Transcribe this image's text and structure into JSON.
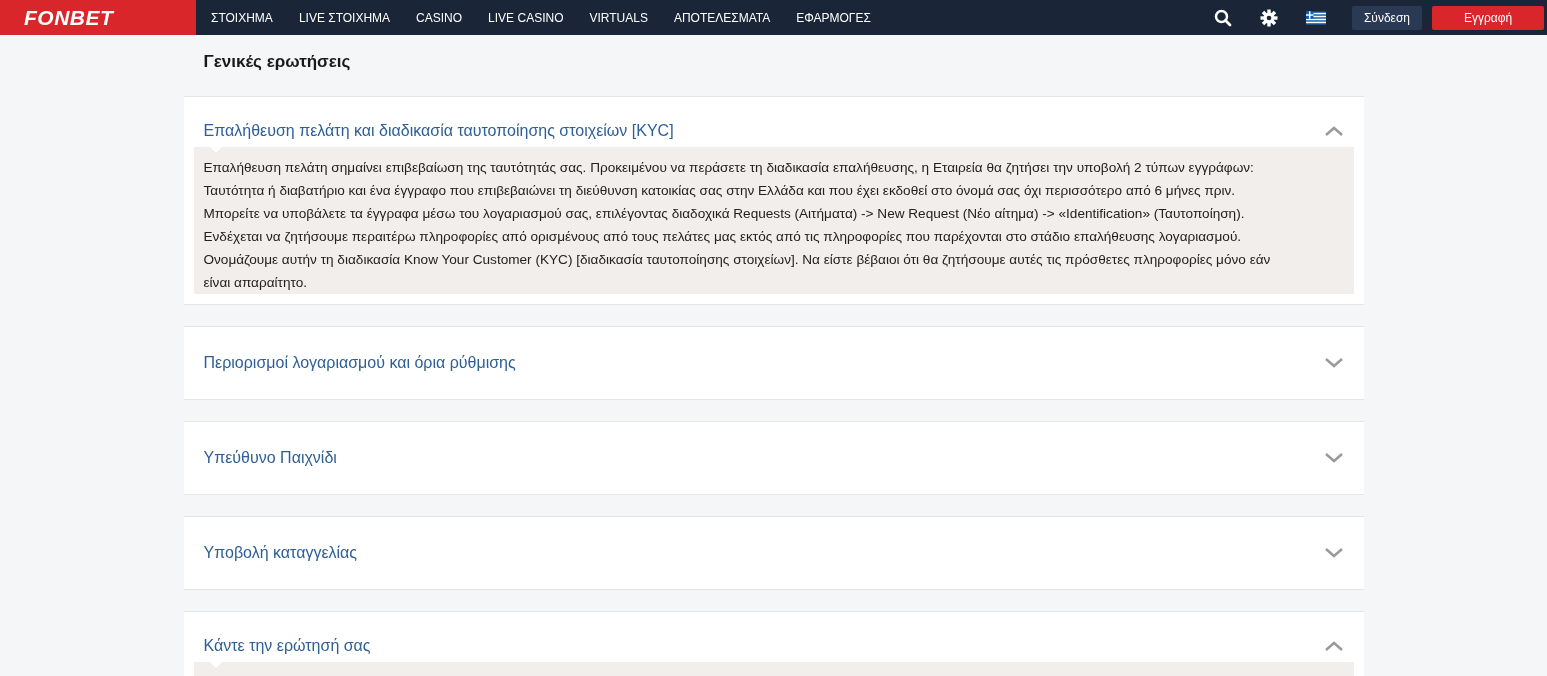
{
  "header": {
    "logo": "FONBET",
    "nav": [
      {
        "label": "ΣΤΟΙΧΗΜΑ"
      },
      {
        "label": "LIVE ΣΤΟΙΧΗΜΑ"
      },
      {
        "label": "CASINO"
      },
      {
        "label": "LIVE CASINO"
      },
      {
        "label": "VIRTUALS"
      },
      {
        "label": "ΑΠΟΤΕΛΕΣΜΑΤΑ"
      },
      {
        "label": "ΕΦΑΡΜΟΓΕΣ"
      }
    ],
    "login": "Σύνδεση",
    "register": "Εγγραφή"
  },
  "page_title": "Γενικές ερωτήσεις",
  "faq": [
    {
      "question": "Επαλήθευση πελάτη και διαδικασία ταυτοποίησης στοιχείων [KYC]",
      "expanded": true,
      "answer_lines": [
        "Επαλήθευση πελάτη σημαίνει επιβεβαίωση της ταυτότητάς σας. Προκειμένου να περάσετε τη διαδικασία επαλήθευσης, η Εταιρεία θα ζητήσει την υποβολή 2 τύπων εγγράφων:",
        "Ταυτότητα ή διαβατήριο και ένα έγγραφο που επιβεβαιώνει τη διεύθυνση κατοικίας σας στην Ελλάδα και που έχει εκδοθεί στο όνομά σας όχι περισσότερο από 6 μήνες πριν.",
        "Μπορείτε να υποβάλετε τα έγγραφα μέσω του λογαριασμού σας, επιλέγοντας διαδοχικά Requests (Αιτήματα) -> New Request (Νέο αίτημα) -> «Identification» (Ταυτοποίηση).",
        "Ενδέχεται να ζητήσουμε περαιτέρω πληροφορίες από ορισμένους από τους πελάτες μας εκτός από τις πληροφορίες που παρέχονται στο στάδιο επαλήθευσης λογαριασμού.",
        "Ονομάζουμε αυτήν τη διαδικασία Know Your Customer (KYC) [διαδικασία ταυτοποίησης στοιχείων]. Να είστε βέβαιοι ότι θα ζητήσουμε αυτές τις πρόσθετες πληροφορίες μόνο εάν",
        "είναι απαραίτητο."
      ]
    },
    {
      "question": "Περιορισμοί λογαριασμού και όρια ρύθμισης",
      "expanded": false
    },
    {
      "question": "Υπεύθυνο Παιχνίδι",
      "expanded": false
    },
    {
      "question": "Υποβολή καταγγελίας",
      "expanded": false
    },
    {
      "question": "Κάντε την ερώτησή σας",
      "expanded": true
    }
  ]
}
